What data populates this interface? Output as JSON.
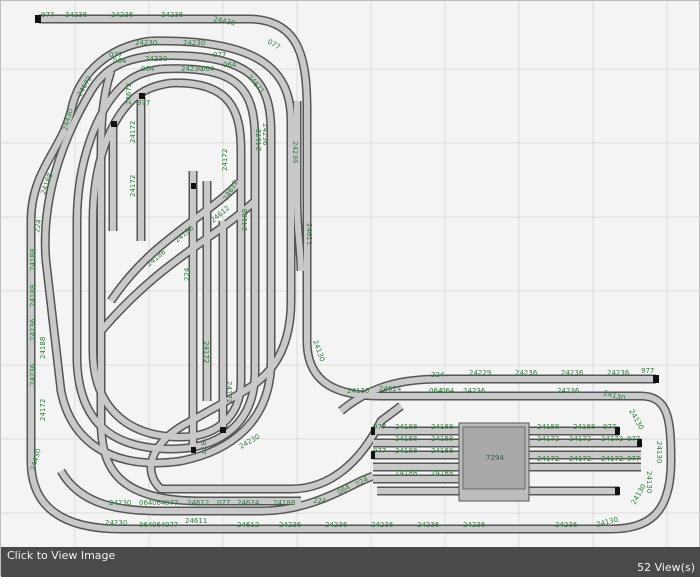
{
  "footer": {
    "caption": "Click to View Image",
    "view_count": "52",
    "view_suffix": "View(s)"
  },
  "colors": {
    "track_fill": "#c9c9c9",
    "track_edge": "#555555",
    "label": "#2f7d3f",
    "grid": "#dcdcdc",
    "background": "#f4f4f4",
    "footer_bar": "#4a4a4a"
  },
  "turntable_label": "7294",
  "labels": {
    "top_row": [
      "977",
      "24236",
      "24236",
      "24236",
      "24430"
    ],
    "inner_oval": [
      "077",
      "24230",
      "24230",
      "077",
      "24671",
      "24672",
      "064",
      "064",
      "24230",
      "24230",
      "064",
      "064",
      "077"
    ],
    "left_side": [
      "24430",
      "24672",
      "24188",
      "224",
      "24188",
      "24188",
      "24236",
      "24188",
      "24236",
      "24172",
      "24430"
    ],
    "center_yard": [
      "24172",
      "24172",
      "24172",
      "24172",
      "24172",
      "977",
      "977",
      "224",
      "24188",
      "24186",
      "24612",
      "24612",
      "24188",
      "24230"
    ],
    "right_spur": [
      "24236",
      "24236",
      "24611",
      "24172",
      "24130"
    ],
    "bottom_left": [
      "24230",
      "064",
      "064",
      "077",
      "24612",
      "077",
      "24624",
      "24188",
      "224",
      "064",
      "224"
    ],
    "bottom_main": [
      "24230",
      "064",
      "064",
      "077",
      "24611",
      "24612",
      "24236",
      "24236",
      "24236",
      "24236",
      "24236",
      "24236",
      "24130"
    ],
    "right_upper": [
      "24130",
      "24624",
      "224",
      "24229",
      "24236",
      "24236",
      "24236",
      "977",
      "064",
      "064",
      "24236",
      "24236",
      "24130"
    ],
    "right_yard": [
      "977",
      "24188",
      "24188",
      "24188",
      "24188",
      "977",
      "24188",
      "24188",
      "24188",
      "24188",
      "24172",
      "24172",
      "24172",
      "977",
      "24172",
      "24172",
      "24172",
      "977",
      "24188",
      "24188",
      "977",
      "24130",
      "24130",
      "24130",
      "24130"
    ]
  }
}
